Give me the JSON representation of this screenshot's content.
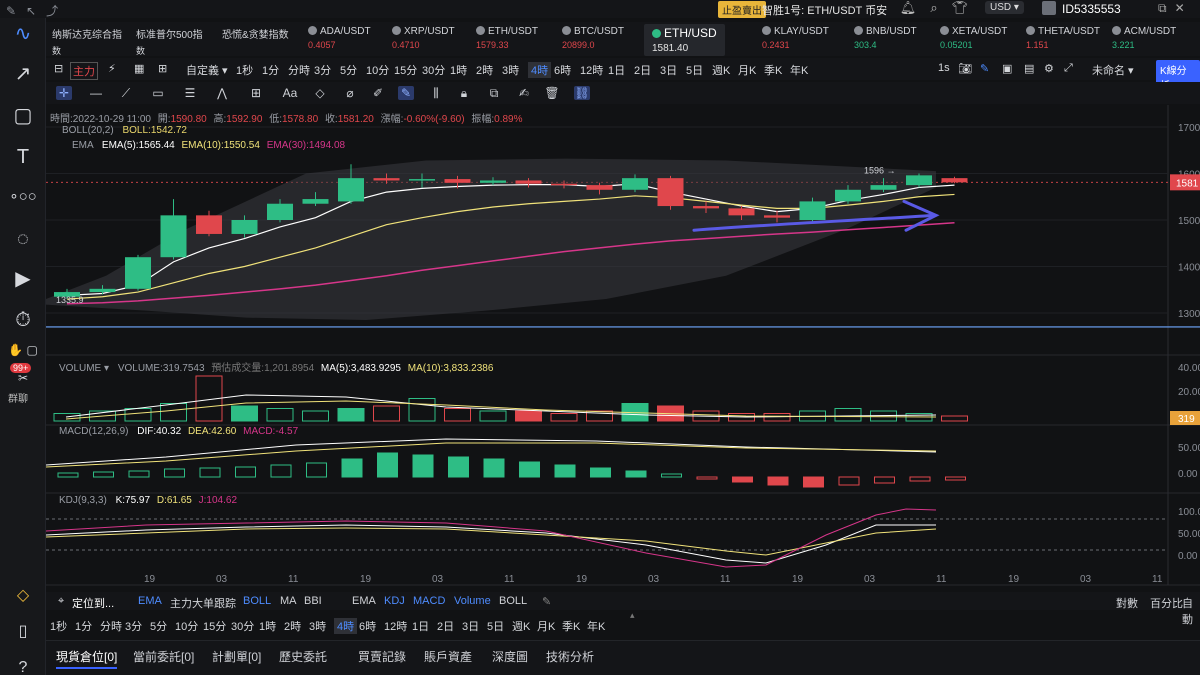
{
  "topbar": {
    "stop_badge": "止盈賣出",
    "title": "智胜1号: ETH/USDT 币安",
    "currency": "USD ▾",
    "user_id": "ID5335553"
  },
  "left_tools": {
    "badge": "99+",
    "group_label": "群聊"
  },
  "tickers": [
    {
      "name": "纳斯达克综合指",
      "sub": "数",
      "color": "#d2d4d9"
    },
    {
      "name": "标准普尔500指",
      "sub": "数",
      "color": "#d2d4d9"
    },
    {
      "name": "恐慌&贪婪指数",
      "sub": "",
      "color": "#d2d4d9"
    },
    {
      "name": "ADA/USDT",
      "sub": "0.4057",
      "color": "#e0474c"
    },
    {
      "name": "XRP/USDT",
      "sub": "0.4710",
      "color": "#e0474c"
    },
    {
      "name": "ETH/USDT",
      "sub": "1579.33",
      "color": "#e0474c"
    },
    {
      "name": "BTC/USDT",
      "sub": "20899.0",
      "color": "#e0474c"
    },
    {
      "name": "ETH/USD",
      "sub": "1581.40",
      "color": "#e5e5e5"
    },
    {
      "name": "KLAY/USDT",
      "sub": "0.2431",
      "color": "#e0474c"
    },
    {
      "name": "BNB/USDT",
      "sub": "303.4",
      "color": "#2ebd85"
    },
    {
      "name": "XETA/USDT",
      "sub": "0.05201",
      "color": "#2ebd85"
    },
    {
      "name": "THETA/USDT",
      "sub": "1.151",
      "color": "#e0474c"
    },
    {
      "name": "ACM/USDT",
      "sub": "3.221",
      "color": "#2ebd85"
    }
  ],
  "timeframes": {
    "main_label": "主力",
    "custom": "自定義 ▾",
    "items": [
      "1秒",
      "1分",
      "分時",
      "3分",
      "5分",
      "10分",
      "15分",
      "30分",
      "1時",
      "2時",
      "3時",
      "4時",
      "6時",
      "12時",
      "1日",
      "2日",
      "3日",
      "5日",
      "週K",
      "月K",
      "季K",
      "年K"
    ],
    "active": "4時",
    "right_interval": "1s",
    "unnamed": "未命名 ▾",
    "kline_btn": "K線分析"
  },
  "ohlc_line": {
    "time": "時間:2022-10-29 11:00",
    "open_label": "開:",
    "open": "1590.80",
    "high_label": "高:",
    "high": "1592.90",
    "low_label": "低:",
    "low": "1578.80",
    "close_label": "收:",
    "close": "1581.20",
    "change_label": "漲幅:",
    "change": "-0.60%(-9.60)",
    "amp_label": "振幅:",
    "amp": "0.89%"
  },
  "boll_line": {
    "name": "BOLL(20,2)",
    "value": "BOLL:1542.72"
  },
  "ema_line": {
    "name": "EMA",
    "ema5": "EMA(5):1565.44",
    "ema10": "EMA(10):1550.54",
    "ema30": "EMA(30):1494.08"
  },
  "volume_line": {
    "name": "VOLUME ▾",
    "vol": "VOLUME:319.7543",
    "est": "預估成交量:1,201.8954",
    "ma5": "MA(5):3,483.9295",
    "ma10": "MA(10):3,833.2386"
  },
  "macd_line": {
    "name": "MACD(12,26,9)",
    "dif": "DIF:40.32",
    "dea": "DEA:42.60",
    "macd": "MACD:-4.57"
  },
  "kdj_line": {
    "name": "KDJ(9,3,3)",
    "k": "K:75.97",
    "d": "D:61.65",
    "j": "J:104.62"
  },
  "annotations": {
    "peak": "1596 →",
    "low_label": "1335.9"
  },
  "price_axis": {
    "ticks": [
      "1700",
      "1600",
      "1500",
      "1400",
      "1300"
    ],
    "current": "1581",
    "vol_ticks": [
      "40.00",
      "20.00"
    ],
    "vol_current": "319",
    "macd_ticks": [
      "50.00",
      "0.00"
    ],
    "kdj_ticks": [
      "100.00",
      "50.00",
      "0.00"
    ]
  },
  "date_axis": [
    "19",
    "03",
    "11",
    "19",
    "03",
    "11",
    "19",
    "03",
    "11",
    "19",
    "03",
    "11",
    "19",
    "03",
    "11"
  ],
  "indicator_bar": {
    "locate": "定位到...",
    "left": [
      "EMA",
      "主力大单跟踪",
      "BOLL",
      "MA",
      "BBI"
    ],
    "right": [
      "EMA",
      "KDJ",
      "MACD",
      "Volume",
      "BOLL"
    ],
    "log": "對數",
    "pct": "百分比",
    "auto": "自動"
  },
  "bottom_tabs": {
    "items": [
      "現貨倉位[0]",
      "當前委託[0]",
      "計劃單[0]",
      "歷史委託",
      "買賣記錄",
      "賬戶資產",
      "深度圖",
      "技術分析"
    ],
    "active": "現貨倉位[0]"
  },
  "colors": {
    "up": "#2ebd85",
    "down": "#e0474c",
    "accent": "#3a62ff",
    "ema5": "#ffffff",
    "ema10": "#f0e27a",
    "ema30": "#d6368a",
    "boll": "#e9d66b"
  }
}
